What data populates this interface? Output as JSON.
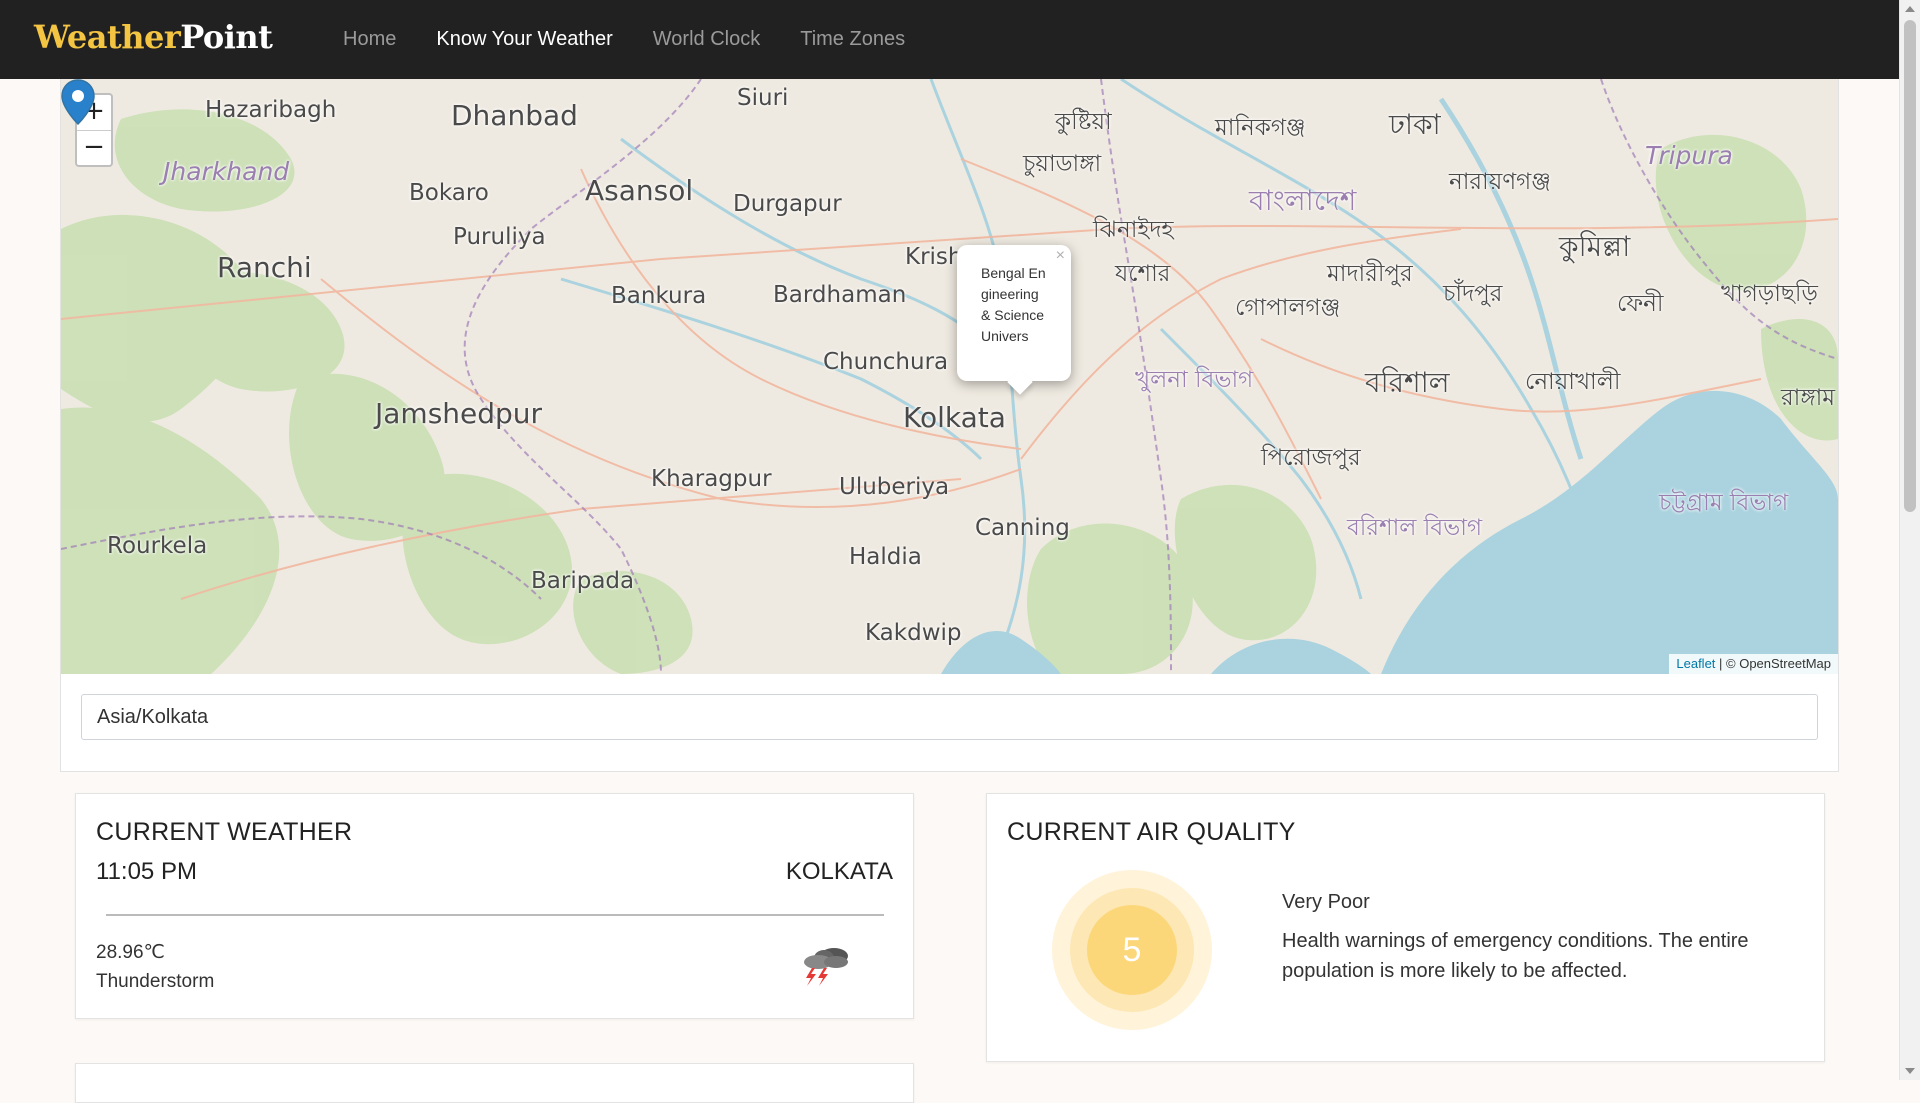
{
  "brand": {
    "part1": "Weather",
    "part2": "Point"
  },
  "nav": {
    "items": [
      {
        "label": "Home",
        "active": false
      },
      {
        "label": "Know Your Weather",
        "active": true
      },
      {
        "label": "World Clock",
        "active": false
      },
      {
        "label": "Time Zones",
        "active": false
      }
    ]
  },
  "map": {
    "zoom_in": "+",
    "zoom_out": "−",
    "popup_text": "Bengal Engineering& Science Univers",
    "popup_close": "×",
    "attribution_link": "Leaflet",
    "attribution_text": " | © OpenStreetMap",
    "labels": {
      "siuri": "Siuri",
      "hazaribagh": "Hazaribagh",
      "dhanbad": "Dhanbad",
      "jharkhand": "Jharkhand",
      "bokaro": "Bokaro",
      "asansol": "Asansol",
      "durgapur": "Durgapur",
      "purulia": "Puruliya",
      "ranchi": "Ranchi",
      "bankura": "Bankura",
      "bardhaman": "Bardhaman",
      "krish": "Krish",
      "chunchura": "Chunchura",
      "jamshedpur": "Jamshedpur",
      "kolkata": "Kolkata",
      "kharagpur": "Kharagpur",
      "uluberiya": "Uluberiya",
      "canning": "Canning",
      "rourkela": "Rourkela",
      "haldia": "Haldia",
      "baripada": "Baripada",
      "kakdwip": "Kakdwip",
      "tripura": "Tripura",
      "kushtia": "কুষ্টিয়া",
      "manikganj": "মানিকগঞ্জ",
      "dhaka": "ঢাকা",
      "chuadanga": "চুয়াডাঙ্গা",
      "bangladesh": "বাংলাদেশ",
      "narayanganj": "নারায়ণগঞ্জ",
      "jhenaidah": "ঝিনাইদহ",
      "cumilla": "কুমিল্লা",
      "jessore": "যশোর",
      "madaripur": "মাদারীপুর",
      "chandpur": "চাঁদপুর",
      "khagrachhari": "খাগড়াছড়ি",
      "gopalganj": "গোপালগঞ্জ",
      "feni": "ফেনী",
      "khulna_div": "খুলনা বিভাগ",
      "barishal": "বরিশাল",
      "noakhali": "নোয়াখালী",
      "rangamati": "রাঙ্গাম",
      "pirojpur": "পিরোজপুর",
      "chattogram_div": "চট্টগ্রাম বিভাগ",
      "barishal_div": "বরিশাল বিভাগ"
    },
    "colors": {
      "land": "#efeae1",
      "water": "#aad3df",
      "forest": "#c8dfb0",
      "border": "#a07cb8",
      "road": "#f2b8a0"
    }
  },
  "timezone_input": {
    "value": "Asia/Kolkata"
  },
  "weather": {
    "title": "CURRENT WEATHER",
    "time": "11:05 PM",
    "city": "KOLKATA",
    "temperature": "28.96℃",
    "condition": "Thunderstorm",
    "icon": "thunderstorm-icon"
  },
  "air_quality": {
    "title": "CURRENT AIR QUALITY",
    "aqi": "5",
    "level": "Very Poor",
    "description": "Health warnings of emergency conditions. The entire population is more likely to be affected.",
    "colors": {
      "outer": "#fff3d9",
      "middle": "#fde7b4",
      "core": "#fcd77a"
    }
  }
}
